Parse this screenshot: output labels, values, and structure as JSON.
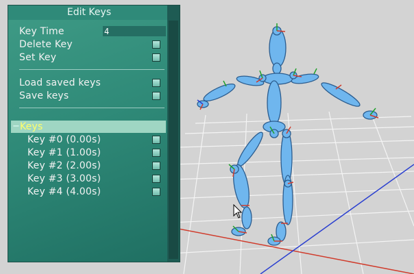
{
  "panel": {
    "title": "Edit Keys",
    "key_time_label": "Key Time",
    "key_time_value": "4",
    "delete_key_label": "Delete Key",
    "set_key_label": "Set Key",
    "load_saved_keys_label": "Load saved keys",
    "save_keys_label": "Save keys",
    "keys_header": "Keys",
    "keys_toggle": "−",
    "keys": [
      {
        "label": "Key #0 (0.00s)"
      },
      {
        "label": "Key #1 (1.00s)"
      },
      {
        "label": "Key #2 (2.00s)"
      },
      {
        "label": "Key #3 (3.00s)"
      },
      {
        "label": "Key #4 (4.00s)"
      }
    ]
  },
  "colors": {
    "panel_bg": "#2f8a78",
    "bone": "#6fb6ee",
    "bone_outline": "#2b5c8e",
    "axis_x": "#d03b2b",
    "axis_y": "#1fa02a",
    "axis_z": "#2a3fd0",
    "grid": "#ffffff",
    "highlight_text": "#ffff6a"
  },
  "icons": {
    "cursor": "mouse-pointer-icon"
  }
}
